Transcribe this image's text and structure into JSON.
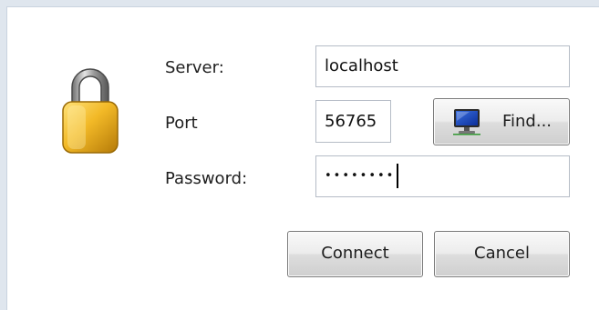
{
  "connection_form": {
    "server_label": "Server:",
    "server_value": "localhost",
    "port_label": "Port",
    "port_value": "56765",
    "password_label": "Password:",
    "password_value": "••••••••"
  },
  "buttons": {
    "find_label": "Find...",
    "connect_label": "Connect",
    "cancel_label": "Cancel"
  },
  "icons": {
    "lock": "padlock-icon",
    "find": "computer-monitor-icon"
  },
  "colors": {
    "lock_gold": "#e8b420",
    "field_border": "#b5bcc6"
  }
}
